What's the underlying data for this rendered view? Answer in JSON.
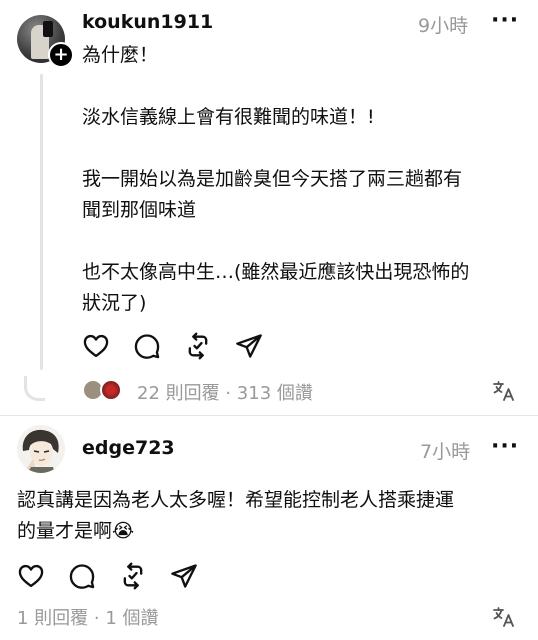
{
  "post1": {
    "username": "koukun1911",
    "time": "9小時",
    "more": "···",
    "text_lines": [
      "為什麼！",
      "",
      "淡水信義線上會有很難聞的味道！!",
      "",
      "我一開始以為是加齡臭但今天搭了兩三趟都有",
      "聞到那個味道",
      "",
      "也不太像高中生…(雖然最近應該快出現恐怖的",
      "狀況了)"
    ],
    "stats": "22 則回覆 · 313 個讚",
    "translate_icon": "translate-icon",
    "actions": [
      "heart-icon",
      "comment-icon",
      "repost-icon",
      "share-icon"
    ]
  },
  "post2": {
    "username": "edge723",
    "time": "7小時",
    "more": "···",
    "text_lines": [
      "認真講是因為老人太多喔！希望能控制老人搭乘捷運",
      "的量才是啊😭"
    ],
    "stats": "1 則回覆 · 1 個讚",
    "translate_icon": "translate-icon",
    "actions": [
      "heart-icon",
      "comment-icon",
      "repost-icon",
      "share-icon"
    ]
  },
  "colors": {
    "text": "#101010",
    "muted": "#999999",
    "thread_line": "#e3e3e3",
    "divider": "#e6e6e6"
  }
}
